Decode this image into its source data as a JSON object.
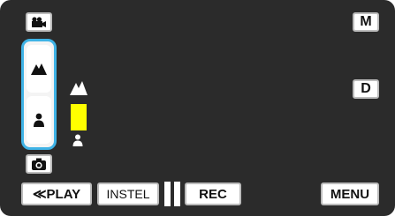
{
  "top_left": {
    "icon": "video-mode-icon"
  },
  "top_right": {
    "label": "M"
  },
  "mid_right": {
    "label": "D"
  },
  "zoom": {
    "tele_icon": "mountains-tele-icon",
    "wide_icon": "person-wide-icon",
    "level": 0.47
  },
  "zoom_indicator": {
    "top_icon": "mountains-small-icon",
    "bottom_icon": "person-small-icon",
    "fill_color": "#ffff00"
  },
  "camera_button": {
    "icon": "camera-icon"
  },
  "bottom": {
    "play_label": "≪PLAY",
    "instel_label": "INSTEL",
    "rec_label": "REC",
    "menu_label": "MENU"
  },
  "colors": {
    "accent": "#3fb3e6",
    "background": "#2b2b2b",
    "zoom_fill": "#ffff00"
  }
}
